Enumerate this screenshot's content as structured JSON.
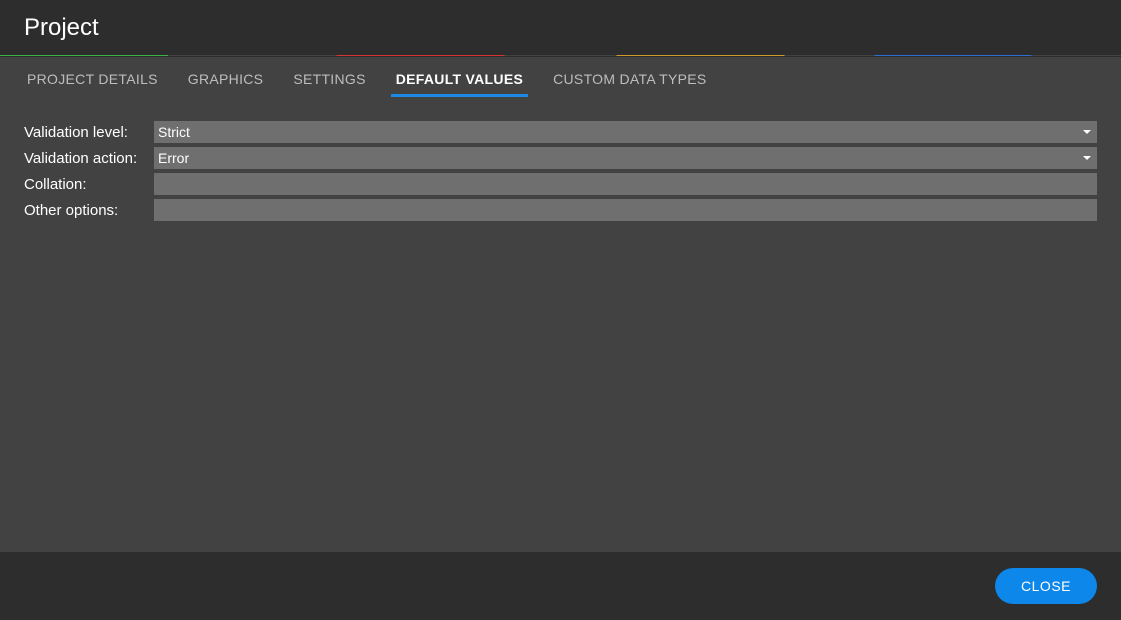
{
  "header": {
    "title": "Project"
  },
  "tabs": {
    "projectDetails": "PROJECT DETAILS",
    "graphics": "GRAPHICS",
    "settings": "SETTINGS",
    "defaultValues": "DEFAULT VALUES",
    "customDataTypes": "CUSTOM DATA TYPES"
  },
  "form": {
    "validationLevel": {
      "label": "Validation level:",
      "value": "Strict"
    },
    "validationAction": {
      "label": "Validation action:",
      "value": "Error"
    },
    "collation": {
      "label": "Collation:",
      "value": ""
    },
    "otherOptions": {
      "label": "Other options:",
      "value": ""
    }
  },
  "footer": {
    "close": "CLOSE"
  }
}
